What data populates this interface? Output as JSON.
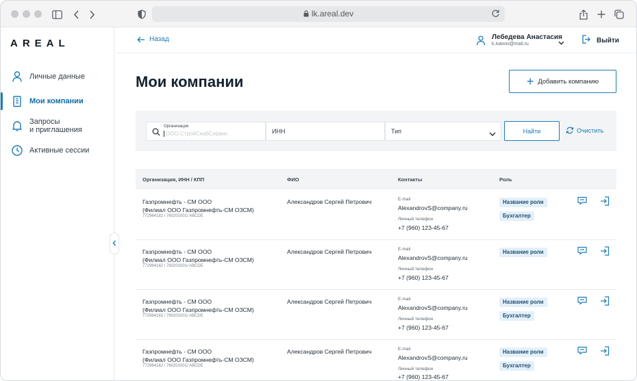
{
  "browser": {
    "url": "lk.areal.dev"
  },
  "sidebar": {
    "logo": "AREAL",
    "items": [
      {
        "label": "Личные данные",
        "icon": "user-icon"
      },
      {
        "label": "Мои компании",
        "icon": "building-icon",
        "active": true
      },
      {
        "label": "Запросы и приглашения",
        "icon": "bell-icon"
      },
      {
        "label": "Активные сессии",
        "icon": "clock-icon"
      }
    ],
    "item3_line1": "Запросы",
    "item3_line2": "и приглашения"
  },
  "header": {
    "back_label": "Назад",
    "user_name": "Лебедева Анастасия",
    "user_email": "k.ivanov@mail.ru",
    "logout_label": "Выйти"
  },
  "page": {
    "title": "Мои компании",
    "add_button": "Добавить компанию"
  },
  "filter": {
    "org_label": "Организация",
    "org_placeholder": "ООО СтройСнабСервис",
    "inn_label": "ИНН",
    "type_label": "Тип",
    "find_button": "Найти",
    "clear_button": "Очистить"
  },
  "table": {
    "headers": [
      "Организация, ИНН / КПП",
      "ФИО",
      "Контакты",
      "Роль"
    ],
    "rows": [
      {
        "org_line1": "Газпромнефть - СМ ООО",
        "org_line2": "(Филиал ООО Газпромнефть-СМ ОЗСМ)",
        "meta": "772964182 / 760201001/  ABCDE",
        "fio": "Александров Сергей Петрович",
        "email_label": "E-mail",
        "email": "AlexandrovS@company.ru",
        "phone_label": "Личный телефон",
        "phone": "+7 (960) 123-45-67",
        "roles": [
          "Название роли",
          "Бухгалтер"
        ]
      },
      {
        "org_line1": "Газпромнефть - СМ ООО",
        "org_line2": "(Филиал ООО Газпромнефть-СМ ОЗСМ)",
        "meta": "772964182 / 760201001/  ABCDE",
        "fio": "Александров Сергей Петрович",
        "email_label": "E-mail",
        "email": "AlexandrovS@company.ru",
        "phone_label": "Личный телефон",
        "phone": "+7 (960) 123-45-67",
        "roles": [
          "Название роли"
        ]
      },
      {
        "org_line1": "Газпромнефть - СМ ООО",
        "org_line2": "(Филиал ООО Газпромнефть-СМ ОЗСМ)",
        "meta": "772964182 / 760201001/  ABCDE",
        "fio": "Александров Сергей Петрович",
        "email_label": "E-mail",
        "email": "AlexandrovS@company.ru",
        "phone_label": "Личный телефон",
        "phone": "+7 (960) 123-45-67",
        "roles": [
          "Название роли",
          "Бухгалтер"
        ]
      },
      {
        "org_line1": "Газпромнефть - СМ ООО",
        "org_line2": "(Филиал ООО Газпромнефть-СМ ОЗСМ)",
        "meta": "772964182 / 760201001/  ABCDE",
        "fio": "Александров Сергей Петрович",
        "email_label": "E-mail",
        "email": "AlexandrovS@company.ru",
        "phone_label": "Личный телефон",
        "phone": "+7 (960) 123-45-67",
        "roles": [
          "Название роли",
          "Бухгалтер"
        ]
      }
    ]
  },
  "colors": {
    "accent": "#1d7bb5",
    "role_badge_bg": "#e3f0fa",
    "filter_bg": "#f2f4f6"
  }
}
